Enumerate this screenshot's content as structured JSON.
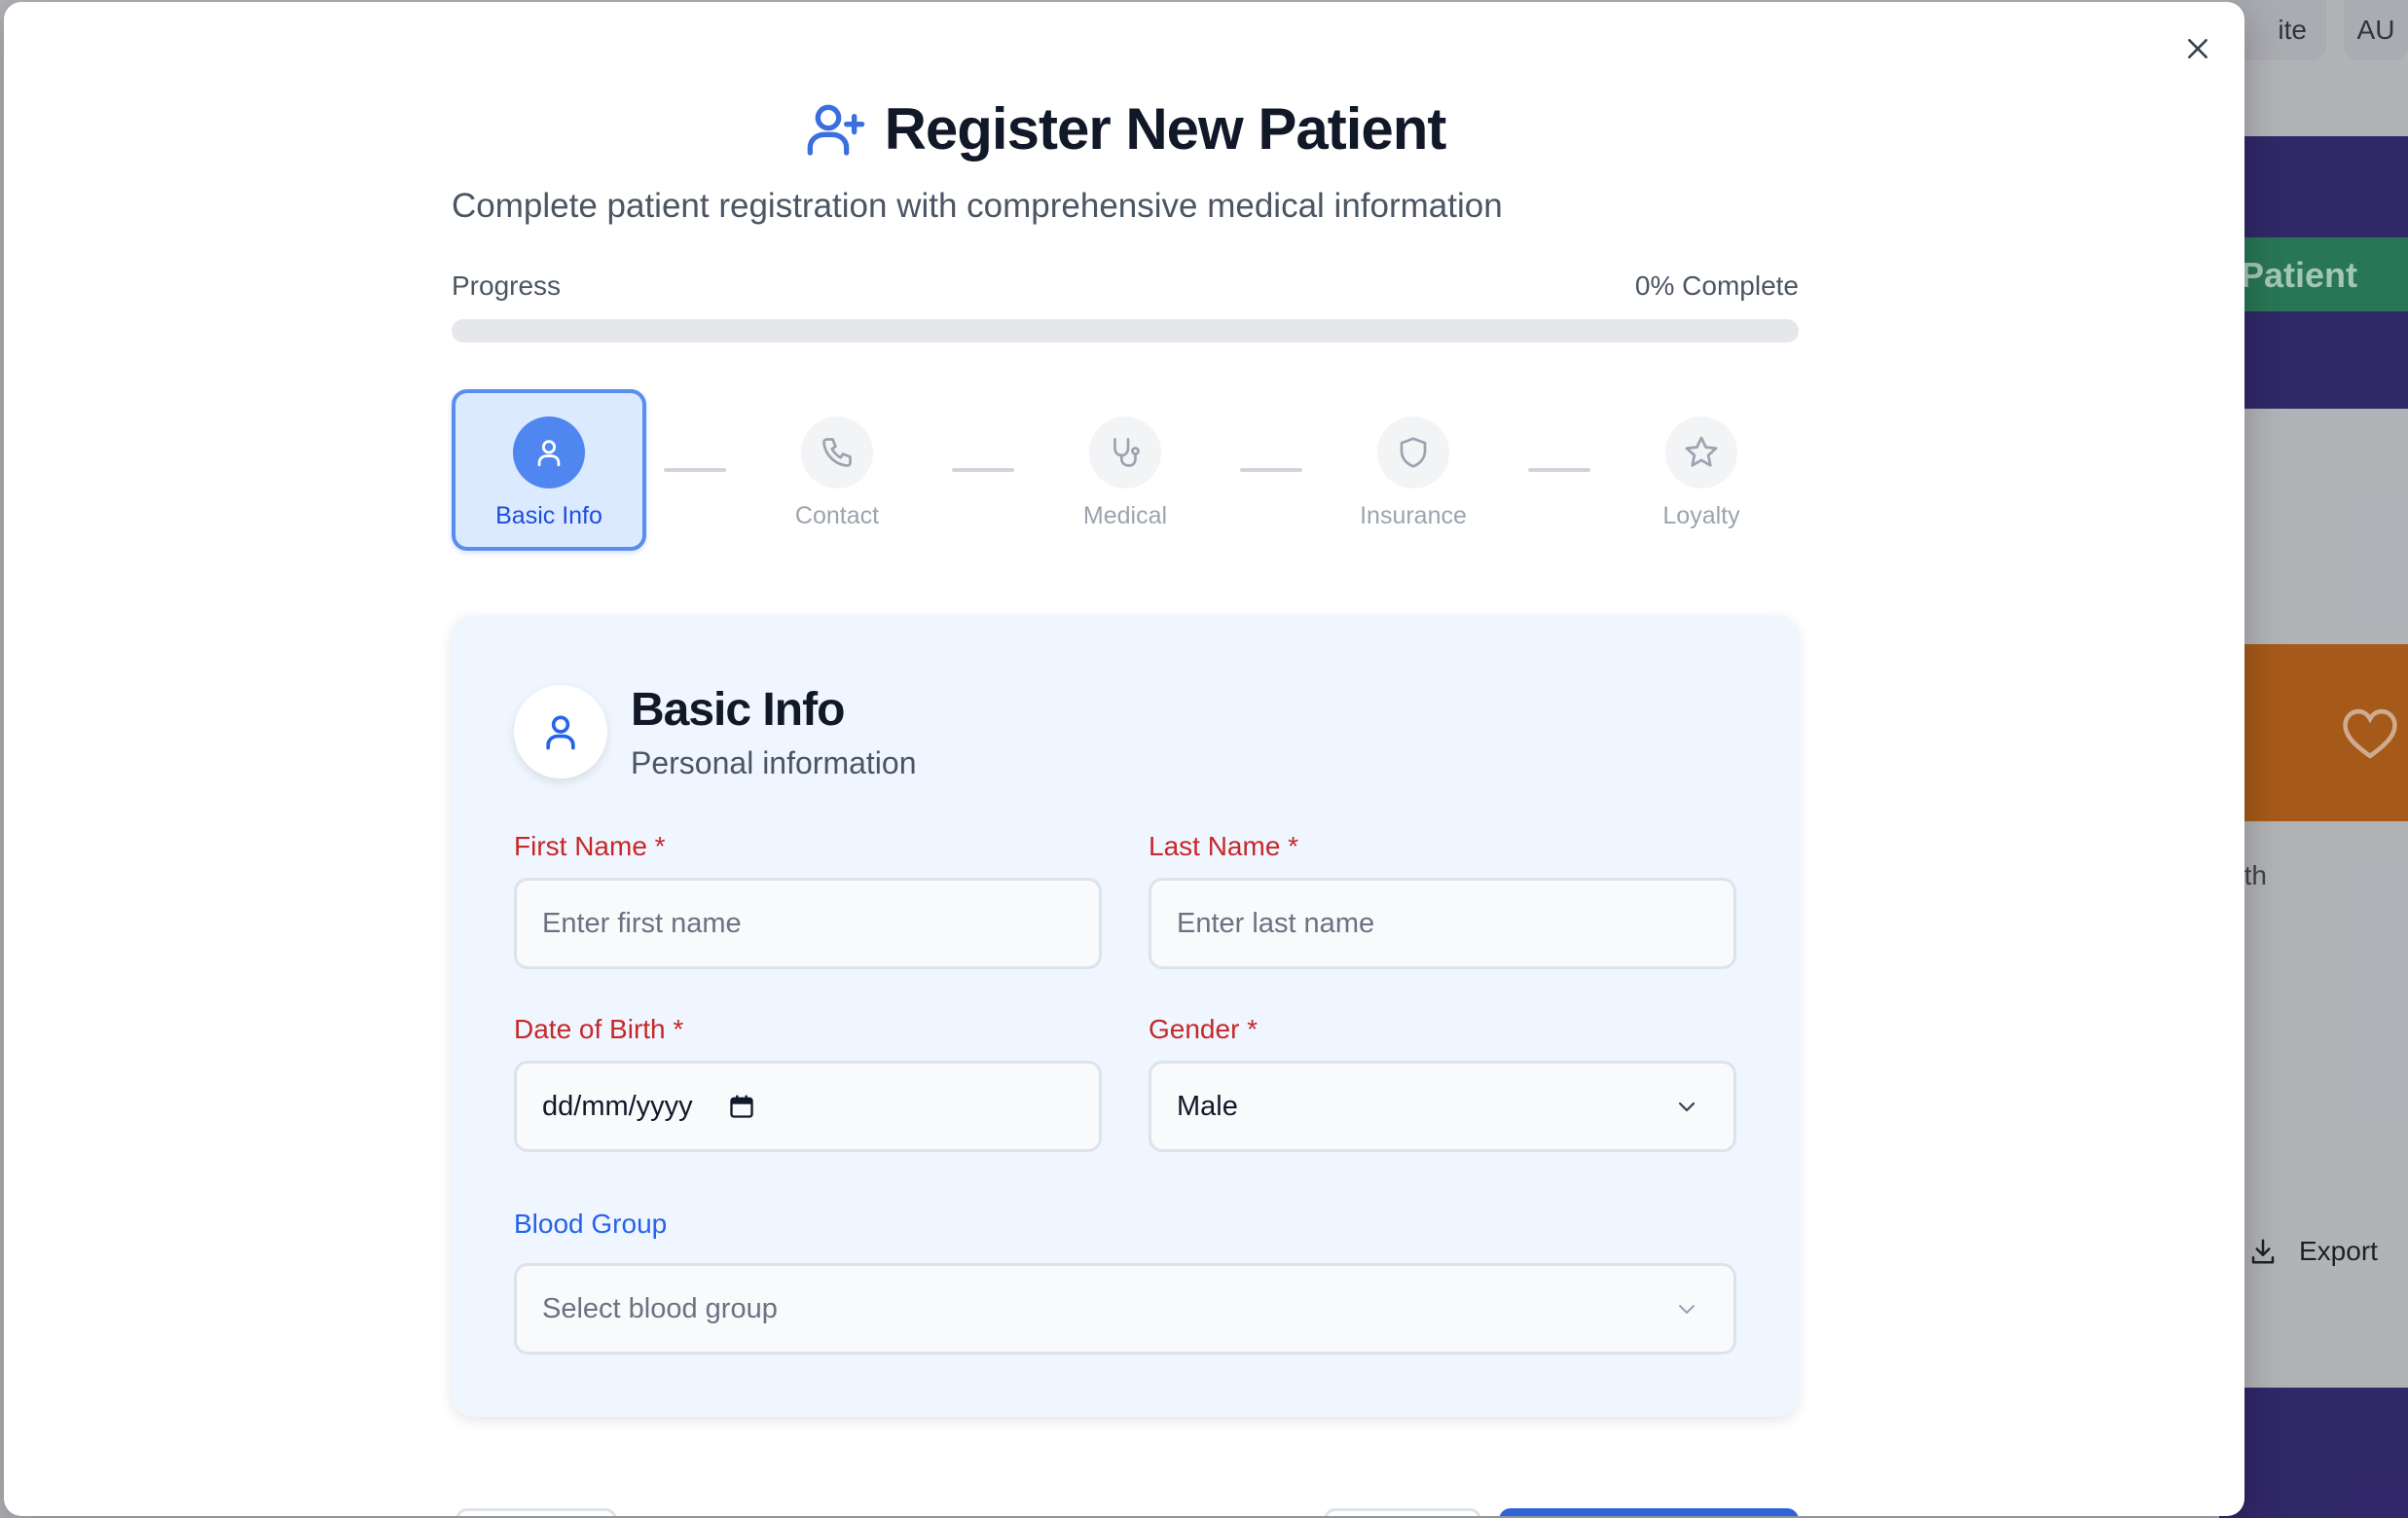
{
  "background": {
    "top_buttons": [
      "ite",
      "AU"
    ],
    "patient_label": "Patient",
    "month_label": "nth",
    "export_label": "Export"
  },
  "modal": {
    "title": "Register New Patient",
    "subtitle": "Complete patient registration with comprehensive medical information",
    "progress": {
      "label": "Progress",
      "percent_text": "0% Complete",
      "value": 0
    },
    "steps": [
      {
        "label": "Basic Info",
        "icon": "user-icon",
        "active": true
      },
      {
        "label": "Contact",
        "icon": "phone-icon",
        "active": false
      },
      {
        "label": "Medical",
        "icon": "stethoscope-icon",
        "active": false
      },
      {
        "label": "Insurance",
        "icon": "shield-icon",
        "active": false
      },
      {
        "label": "Loyalty",
        "icon": "star-icon",
        "active": false
      }
    ],
    "section": {
      "title": "Basic Info",
      "subtitle": "Personal information",
      "fields": {
        "first_name": {
          "label": "First Name *",
          "placeholder": "Enter first name"
        },
        "last_name": {
          "label": "Last Name *",
          "placeholder": "Enter last name"
        },
        "dob": {
          "label": "Date of Birth *",
          "placeholder": "dd/mm/yyyy"
        },
        "gender": {
          "label": "Gender *",
          "value": "Male"
        },
        "blood_group": {
          "label": "Blood Group",
          "placeholder": "Select blood group"
        }
      }
    }
  },
  "colors": {
    "accent": "#3b82f6",
    "required_label": "#c62828",
    "optional_label": "#2563eb"
  }
}
